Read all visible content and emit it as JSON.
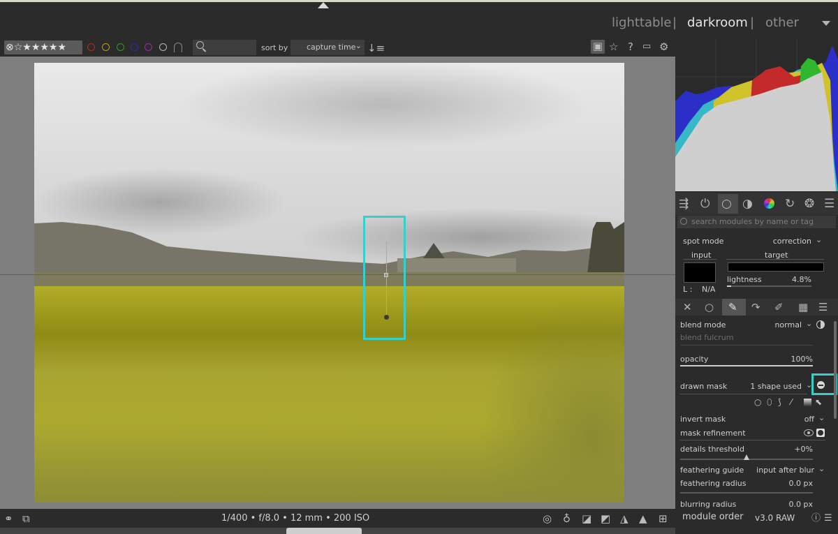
{
  "views": {
    "lighttable": "lighttable",
    "darkroom": "darkroom",
    "other": "other",
    "separator": "|"
  },
  "filter_bar": {
    "rating_stars": "⊗☆★★★★★",
    "color_labels": [
      {
        "name": "red",
        "color": "#b52a2a"
      },
      {
        "name": "yellow",
        "color": "#b8a21a"
      },
      {
        "name": "green",
        "color": "#2f9a2f"
      },
      {
        "name": "blue",
        "color": "#2a2ab0"
      },
      {
        "name": "purple",
        "color": "#a02aa0"
      },
      {
        "name": "none",
        "color": "#b8b8b8"
      }
    ],
    "sort_by_label": "sort by",
    "sort_value": "capture time",
    "sort_dropdown_arrow": "⌄"
  },
  "top_toolbar_icons": [
    "grouping-icon",
    "star-icon",
    "help-icon",
    "keyboard-icon",
    "gear-icon"
  ],
  "image_info": {
    "exif": "1/400 • f/8.0 • 12 mm • 200 ISO"
  },
  "histogram": {
    "colors": {
      "blue": "#2b2fc7",
      "cyan": "#37b8c6",
      "yellow": "#d0c22a",
      "red": "#c42a2a",
      "green": "#2fb82f",
      "gray": "#cfcfcf"
    }
  },
  "module_search": {
    "placeholder": "search modules by name or tag"
  },
  "spot_module": {
    "spot_mode_label": "spot mode",
    "spot_mode_value": "correction",
    "input_label": "input",
    "target_label": "target",
    "l_label": "L :",
    "l_value": "N/A",
    "lightness_label": "lightness",
    "lightness_value": "4.8%",
    "lightness_fraction": 0.048
  },
  "blending": {
    "blend_mode_label": "blend mode",
    "blend_mode_value": "normal",
    "blend_fulcrum_label": "blend fulcrum",
    "opacity_label": "opacity",
    "opacity_value": "100%",
    "opacity_fraction": 1.0,
    "drawn_mask_label": "drawn mask",
    "drawn_mask_value": "1 shape used",
    "invert_mask_label": "invert mask",
    "invert_mask_value": "off",
    "mask_refinement_label": "mask refinement",
    "details_threshold_label": "details threshold",
    "details_threshold_value": "+0%",
    "feathering_guide_label": "feathering guide",
    "feathering_guide_value": "input after blur",
    "feathering_radius_label": "feathering radius",
    "feathering_radius_value": "0.0 px",
    "blurring_radius_label": "blurring radius",
    "blurring_radius_value": "0.0 px"
  },
  "bottom": {
    "module_order_label": "module order",
    "module_order_value": "v3.0 RAW"
  },
  "highlight_color": "#35d0c9"
}
